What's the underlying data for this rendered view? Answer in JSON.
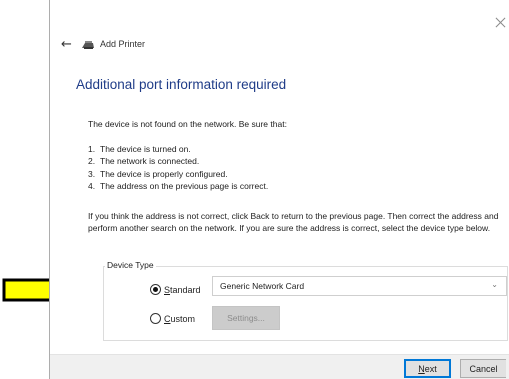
{
  "window": {
    "title": "Add Printer"
  },
  "page": {
    "heading": "Additional port information required"
  },
  "intro": "The device is not found on the network.  Be sure that:",
  "checklist": [
    {
      "num": "1.",
      "text": "The device is turned on."
    },
    {
      "num": "2.",
      "text": "The network is connected."
    },
    {
      "num": "3.",
      "text": "The device is properly configured."
    },
    {
      "num": "4.",
      "text": "The address on the previous page is correct."
    }
  ],
  "paragraph": "If you think the address is not correct, click Back to return to the previous page.  Then correct the address and perform another search on the network.  If you are sure the address is correct, select the device type below.",
  "device_type": {
    "label": "Device Type",
    "standard": {
      "accel": "S",
      "rest": "tandard",
      "selected": true
    },
    "custom": {
      "accel": "C",
      "rest": "ustom",
      "selected": false
    },
    "dropdown_value": "Generic Network Card",
    "settings_label": "Settings..."
  },
  "footer": {
    "next": {
      "accel": "N",
      "rest": "ext"
    },
    "cancel": "Cancel"
  },
  "colors": {
    "heading": "#1f3c88",
    "annotation_arrow_fill": "#ffff00",
    "primary_border": "#0078d7"
  },
  "icons": {
    "back": "back-arrow-icon",
    "printer": "printer-icon",
    "close": "close-icon",
    "dropdown": "chevron-down-icon"
  }
}
